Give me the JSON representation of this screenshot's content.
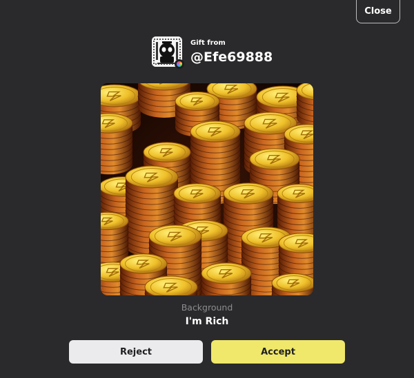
{
  "dialog": {
    "close_label": "Close",
    "gift_from_label": "Gift from",
    "sender_username": "@Efe69888",
    "item_type": "Background",
    "item_name": "I'm Rich",
    "reject_label": "Reject",
    "accept_label": "Accept"
  },
  "icons": {
    "avatar": "robot-avatar-icon",
    "badge": "rainbow-badge-icon",
    "coin_symbol": "lightning-bolt-icon"
  },
  "colors": {
    "background": "#2a2a2c",
    "accept_button": "#efe86b",
    "reject_button": "#ebebed",
    "coin_gold": "#f2c233",
    "coin_copper": "#b5561b"
  }
}
